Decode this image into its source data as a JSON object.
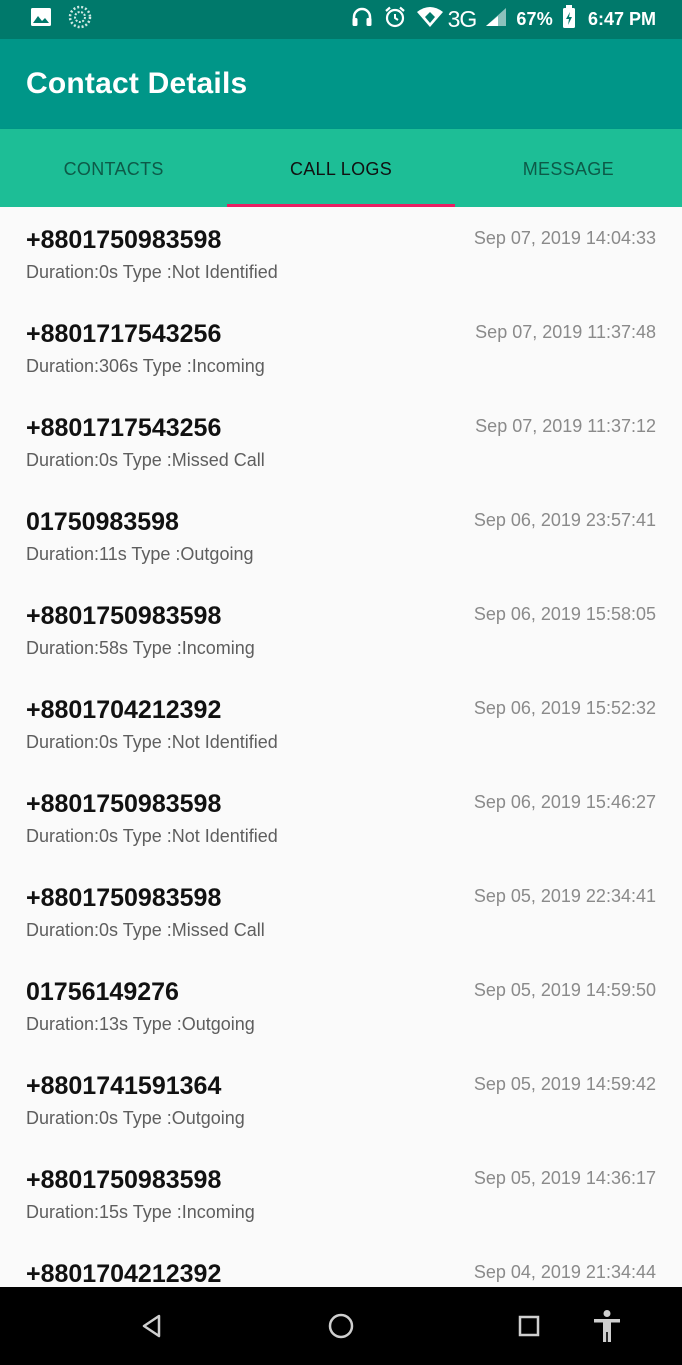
{
  "status_bar": {
    "network": "3G",
    "battery": "67%",
    "time": "6:47 PM",
    "icons": [
      "image-icon",
      "sync-icon",
      "headset-icon",
      "alarm-icon",
      "wifi-icon",
      "signal-icon",
      "battery-icon"
    ]
  },
  "app_bar": {
    "title": "Contact Details"
  },
  "tabs": [
    {
      "label": "CONTACTS",
      "active": false
    },
    {
      "label": "CALL LOGS",
      "active": true
    },
    {
      "label": "MESSAGE",
      "active": false
    }
  ],
  "colors": {
    "status_bar": "#00796b",
    "app_bar": "#009688",
    "tabs": "#1dbe96",
    "tab_indicator": "#e91e63"
  },
  "call_logs": [
    {
      "number": "+8801750983598",
      "detail": "Duration:0s Type :Not Identified",
      "time": "Sep 07, 2019 14:04:33"
    },
    {
      "number": "+8801717543256",
      "detail": "Duration:306s Type :Incoming",
      "time": "Sep 07, 2019 11:37:48"
    },
    {
      "number": "+8801717543256",
      "detail": "Duration:0s Type :Missed Call",
      "time": "Sep 07, 2019 11:37:12"
    },
    {
      "number": "01750983598",
      "detail": "Duration:11s Type :Outgoing",
      "time": "Sep 06, 2019 23:57:41"
    },
    {
      "number": "+8801750983598",
      "detail": "Duration:58s Type :Incoming",
      "time": "Sep 06, 2019 15:58:05"
    },
    {
      "number": "+8801704212392",
      "detail": "Duration:0s Type :Not Identified",
      "time": "Sep 06, 2019 15:52:32"
    },
    {
      "number": "+8801750983598",
      "detail": "Duration:0s Type :Not Identified",
      "time": "Sep 06, 2019 15:46:27"
    },
    {
      "number": "+8801750983598",
      "detail": "Duration:0s Type :Missed Call",
      "time": "Sep 05, 2019 22:34:41"
    },
    {
      "number": "01756149276",
      "detail": "Duration:13s Type :Outgoing",
      "time": "Sep 05, 2019 14:59:50"
    },
    {
      "number": "+8801741591364",
      "detail": "Duration:0s Type :Outgoing",
      "time": "Sep 05, 2019 14:59:42"
    },
    {
      "number": "+8801750983598",
      "detail": "Duration:15s Type :Incoming",
      "time": "Sep 05, 2019 14:36:17"
    },
    {
      "number": "+8801704212392",
      "detail": "",
      "time": "Sep 04, 2019 21:34:44"
    }
  ],
  "nav_bar": {
    "buttons": [
      "back-icon",
      "home-icon",
      "recents-icon",
      "accessibility-icon"
    ]
  }
}
